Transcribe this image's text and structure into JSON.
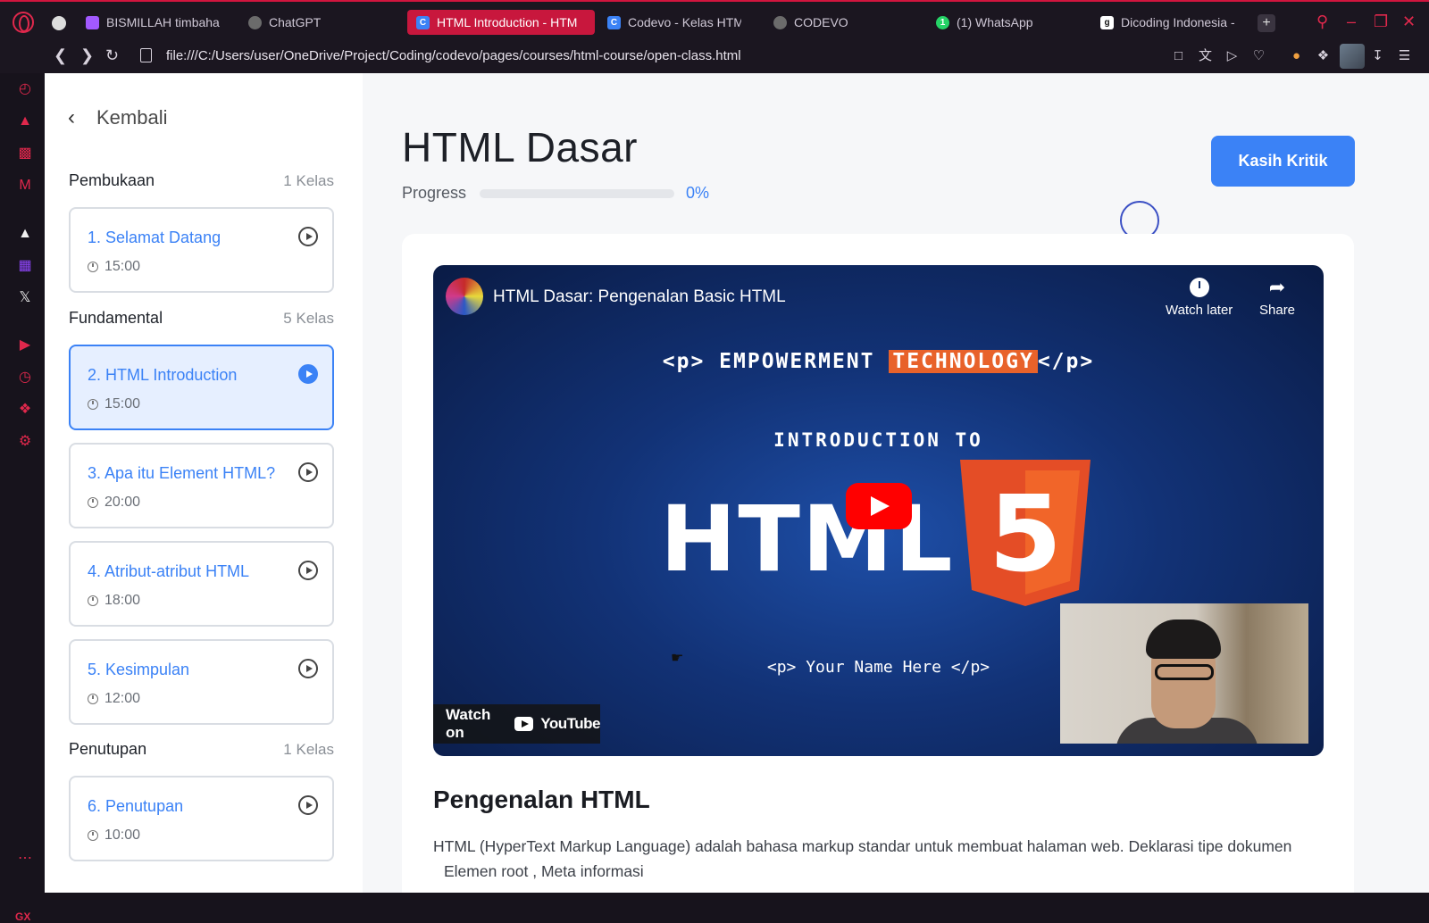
{
  "browser": {
    "tabs": [
      {
        "label": "BISMILLAH timbahag",
        "favicon_color": "#a259ff"
      },
      {
        "label": "ChatGPT",
        "favicon_color": "#888888"
      },
      {
        "label": "HTML Introduction - HTM",
        "favicon_color": "#3b82f6"
      },
      {
        "label": "Codevo - Kelas HTM",
        "favicon_color": "#3b82f6"
      },
      {
        "label": "CODEVO",
        "favicon_color": "#888888"
      },
      {
        "label": "(1) WhatsApp",
        "favicon_color": "#25d366"
      },
      {
        "label": "Dicoding Indonesia -",
        "favicon_color": "#ffffff"
      }
    ],
    "url": "file:///C:/Users/user/OneDrive/Project/Coding/codevo/pages/courses/html-course/open-class.html",
    "accent_color": "#e0284c",
    "rail_label": "GX"
  },
  "sidebar": {
    "back_label": "Kembali",
    "sections": [
      {
        "title": "Pembukaan",
        "count": "1 Kelas",
        "lessons": [
          {
            "title": "1. Selamat Datang",
            "duration": "15:00",
            "active": false
          }
        ]
      },
      {
        "title": "Fundamental",
        "count": "5 Kelas",
        "lessons": [
          {
            "title": "2. HTML Introduction",
            "duration": "15:00",
            "active": true
          },
          {
            "title": "3. Apa itu Element HTML?",
            "duration": "20:00",
            "active": false
          },
          {
            "title": "4. Atribut-atribut HTML",
            "duration": "18:00",
            "active": false
          },
          {
            "title": "5. Kesimpulan",
            "duration": "12:00",
            "active": false
          }
        ]
      },
      {
        "title": "Penutupan",
        "count": "1 Kelas",
        "lessons": [
          {
            "title": "6. Penutupan",
            "duration": "10:00",
            "active": false
          }
        ]
      }
    ]
  },
  "main": {
    "title": "HTML Dasar",
    "progress_label": "Progress",
    "progress_value": "0%",
    "progress_fraction": 0,
    "critique_button": "Kasih Kritik",
    "accent_color": "#3b82f6"
  },
  "video": {
    "title": "HTML Dasar: Pengenalan Basic HTML",
    "watch_later": "Watch later",
    "share": "Share",
    "slide_line_prefix": "<p> EMPOWERMENT ",
    "slide_line_highlight": "TECHNOLOGY",
    "slide_line_suffix": "</p>",
    "slide_intro": "INTRODUCTION TO",
    "slide_html": "HTML",
    "slide_html5_digit": "5",
    "slide_bottom": "<p> Your Name Here </p>",
    "watch_on": "Watch on",
    "youtube_word": "YouTube"
  },
  "article": {
    "heading": "Pengenalan HTML",
    "paragraph": "HTML (HyperText Markup Language) adalah bahasa markup standar untuk membuat halaman web. Deklarasi tipe dokumen",
    "paragraph_line2": "Elemen root , Meta informasi"
  }
}
